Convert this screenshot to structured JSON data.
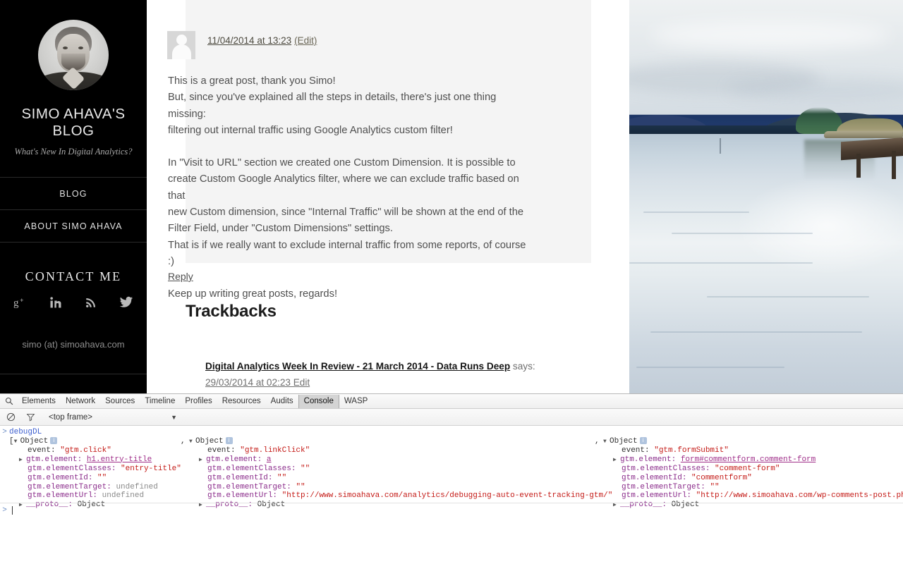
{
  "sidebar": {
    "blog_title": "SIMO AHAVA'S BLOG",
    "tagline": "What's New In Digital Analytics?",
    "nav": [
      {
        "label": "BLOG",
        "name": "nav-blog"
      },
      {
        "label": "ABOUT SIMO AHAVA",
        "name": "nav-about-simo-ahava"
      }
    ],
    "contact_heading": "CONTACT ME",
    "social": [
      {
        "name": "google-plus-icon",
        "label": "Google Plus"
      },
      {
        "name": "linkedin-icon",
        "label": "LinkedIn"
      },
      {
        "name": "rss-icon",
        "label": "RSS"
      },
      {
        "name": "twitter-icon",
        "label": "Twitter"
      }
    ],
    "email": "simo (at) simoahava.com"
  },
  "comment": {
    "date": "11/04/2014 at 13:23",
    "edit": "(Edit)",
    "p1_line1": "This is a great post, thank you Simo!",
    "p1_line2": "But, since you've explained all the steps in details, there's just one thing missing:",
    "p1_line3": "filtering out internal traffic using Google Analytics custom filter!",
    "p2_line1": "In \"Visit to URL\" section we created one Custom Dimension. It is possible to",
    "p2_line2": "create Custom Google Analytics filter, where we can exclude traffic based on that",
    "p2_line3": "new Custom dimension, since \"Internal Traffic\" will be shown at the end of the",
    "p2_line4": "Filter Field, under \"Custom Dimensions\" settings.",
    "p2_line5": "That is if we really want to exclude internal traffic from some reports, of course :)",
    "p3_line1": "Keep up writing great posts, regards!",
    "reply": "Reply"
  },
  "trackbacks": {
    "heading": "Trackbacks",
    "item_title": "Digital Analytics Week In Review - 21 March 2014 - Data Runs Deep",
    "item_says": " says:",
    "item_date": "29/03/2014 at 02:23 Edit"
  },
  "devtools": {
    "tabs": [
      {
        "label": "Elements",
        "active": false
      },
      {
        "label": "Network",
        "active": false
      },
      {
        "label": "Sources",
        "active": false
      },
      {
        "label": "Timeline",
        "active": false
      },
      {
        "label": "Profiles",
        "active": false
      },
      {
        "label": "Resources",
        "active": false
      },
      {
        "label": "Audits",
        "active": false
      },
      {
        "label": "Console",
        "active": true
      },
      {
        "label": "WASP",
        "active": false
      }
    ],
    "search_icon": "search-icon",
    "clear_icon": "clear-console-icon",
    "filter_icon": "filter-icon",
    "frame_selector": "<top frame>",
    "frame_caret": "▼",
    "console": {
      "prompt_symbol": ">",
      "expression": "debugDL",
      "open_bracket": "[",
      "comma": ",",
      "object_word": "Object",
      "objects": [
        {
          "keys": [
            {
              "key": "event:",
              "value": "\"gtm.click\"",
              "type": "string",
              "expandable": false
            },
            {
              "key": "gtm.element:",
              "value": "h1.entry-title",
              "type": "node",
              "expandable": true
            },
            {
              "key": "gtm.elementClasses:",
              "value": "\"entry-title\"",
              "type": "string",
              "expandable": false
            },
            {
              "key": "gtm.elementId:",
              "value": "\"\"",
              "type": "string",
              "expandable": false
            },
            {
              "key": "gtm.elementTarget:",
              "value": "undefined",
              "type": "undefined",
              "expandable": false
            },
            {
              "key": "gtm.elementUrl:",
              "value": "undefined",
              "type": "undefined",
              "expandable": false
            },
            {
              "key": "__proto__:",
              "value": "Object",
              "type": "object",
              "expandable": true
            }
          ]
        },
        {
          "keys": [
            {
              "key": "event:",
              "value": "\"gtm.linkClick\"",
              "type": "string",
              "expandable": false
            },
            {
              "key": "gtm.element:",
              "value": "a",
              "type": "node",
              "expandable": true
            },
            {
              "key": "gtm.elementClasses:",
              "value": "\"\"",
              "type": "string",
              "expandable": false
            },
            {
              "key": "gtm.elementId:",
              "value": "\"\"",
              "type": "string",
              "expandable": false
            },
            {
              "key": "gtm.elementTarget:",
              "value": "\"\"",
              "type": "string",
              "expandable": false
            },
            {
              "key": "gtm.elementUrl:",
              "value": "\"http://www.simoahava.com/analytics/debugging-auto-event-tracking-gtm/\"",
              "type": "string",
              "expandable": false
            },
            {
              "key": "__proto__:",
              "value": "Object",
              "type": "object",
              "expandable": true
            }
          ]
        },
        {
          "keys": [
            {
              "key": "event:",
              "value": "\"gtm.formSubmit\"",
              "type": "string",
              "expandable": false
            },
            {
              "key": "gtm.element:",
              "value": "form#commentform.comment-form",
              "type": "node",
              "expandable": true
            },
            {
              "key": "gtm.elementClasses:",
              "value": "\"comment-form\"",
              "type": "string",
              "expandable": false
            },
            {
              "key": "gtm.elementId:",
              "value": "\"commentform\"",
              "type": "string",
              "expandable": false
            },
            {
              "key": "gtm.elementTarget:",
              "value": "\"\"",
              "type": "string",
              "expandable": false
            },
            {
              "key": "gtm.elementUrl:",
              "value": "\"http://www.simoahava.com/wp-comments-post.php\"",
              "type": "string",
              "expandable": false
            },
            {
              "key": "__proto__:",
              "value": "Object",
              "type": "object",
              "expandable": true
            }
          ]
        }
      ]
    }
  },
  "colors": {
    "sidebar_bg": "#000000",
    "comment_bg": "#f4f4f4",
    "link": "#4d4a3f",
    "console_string": "#c41a16",
    "console_key": "#8b2c8b",
    "console_expr": "#3c5ecf"
  }
}
